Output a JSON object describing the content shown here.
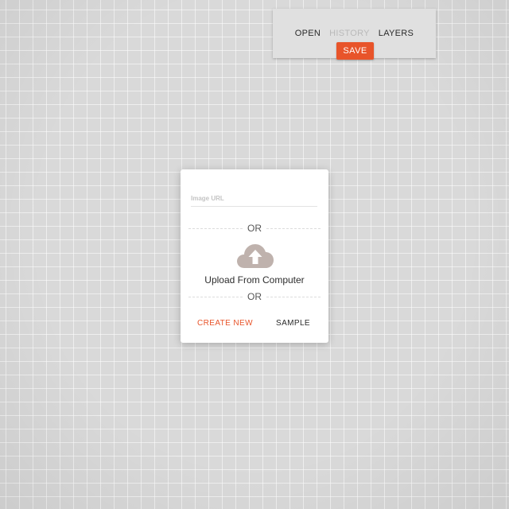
{
  "toolbar": {
    "nav": {
      "open": "OPEN",
      "history": "HISTORY",
      "layers": "LAYERS"
    },
    "save_label": "SAVE",
    "accent_color": "#e8542a"
  },
  "dialog": {
    "url_input": {
      "placeholder": "Image URL",
      "value": ""
    },
    "divider_1": "OR",
    "upload": {
      "icon": "cloud-upload-icon",
      "label": "Upload From Computer"
    },
    "divider_2": "OR",
    "actions": {
      "create_new": "CREATE NEW",
      "sample": "SAMPLE"
    }
  }
}
